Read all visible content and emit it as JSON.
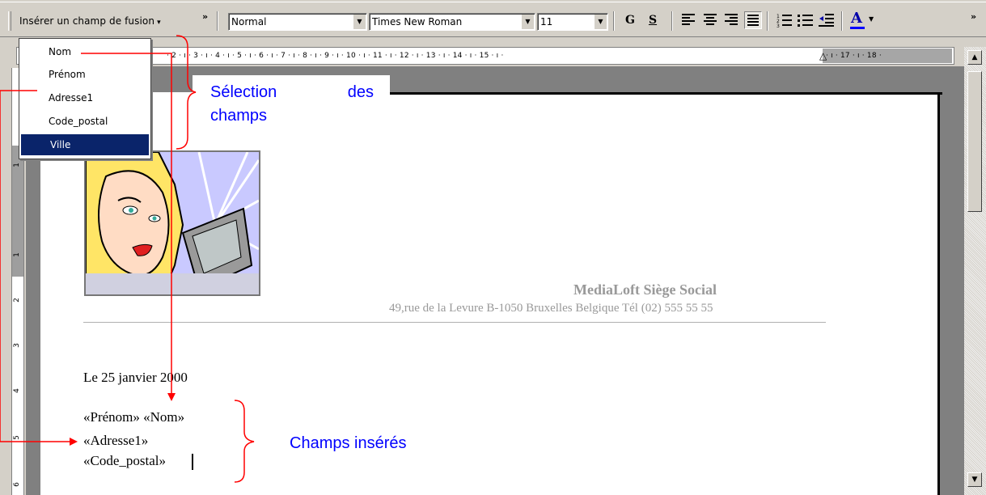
{
  "toolbar": {
    "merge_field_label": "Insérer un champ de fusion",
    "merge_field_arrow": "▾",
    "overflow_glyph": "»",
    "style_value": "Normal",
    "font_value": "Times New Roman",
    "size_value": "11",
    "bold_label": "G",
    "underline_label": "S",
    "font_color_label": "A"
  },
  "ruler": {
    "marks": "· 2 · ı · 3 · ı · 4 · ı · 5 · ı · 6 · ı · 7 · ı · 8 · ı · 9 · ı · 10 · ı · 11 · ı · 12 · ı · 13 · ı · 14 · ı · 15 · ı ·",
    "marks_right": "· ı · 17 · ı · 18 ·",
    "indent_marker": "△"
  },
  "vertical_ruler": [
    "1",
    "1",
    "2",
    "3",
    "4",
    "5",
    "6"
  ],
  "dropdown": {
    "items": [
      "Nom",
      "Prénom",
      "Adresse1",
      "Code_postal",
      "Ville"
    ],
    "selected": "Ville"
  },
  "document": {
    "company": "MediaLoft Siège Social",
    "address": "49,rue de la Levure B-1050 Bruxelles Belgique Tél (02) 555 55 55",
    "date": "Le 25 janvier 2000",
    "line1": "«Prénom» «Nom»",
    "line2": "«Adresse1»",
    "line3": "«Code_postal»"
  },
  "annotations": {
    "selection_word1": "Sélection",
    "selection_word2": "des",
    "selection_line2": "champs",
    "inserted": "Champs insérés",
    "color": "#0000ff",
    "arrow_color": "#ff0000"
  },
  "colors": {
    "chrome": "#d4d0c8",
    "selection": "#0a246a"
  },
  "icons": [
    "align-left-icon",
    "align-center-icon",
    "align-right-icon",
    "justify-icon",
    "numbered-list-icon",
    "bullet-list-icon",
    "decrease-indent-icon",
    "font-color-icon",
    "scroll-up-icon",
    "scroll-down-icon"
  ]
}
